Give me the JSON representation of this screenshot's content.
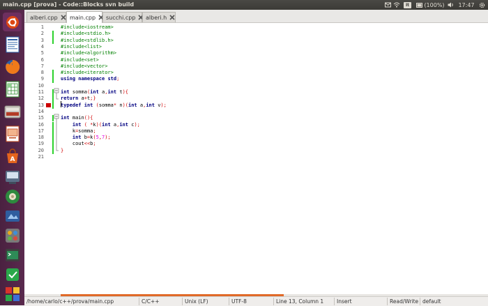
{
  "window": {
    "title": "main.cpp [prova] - Code::Blocks svn build"
  },
  "panel": {
    "keyboard": "It",
    "battery": "(100%)",
    "time": "17:47"
  },
  "launcher": {
    "items": [
      {
        "name": "ubuntu-dash-icon"
      },
      {
        "name": "libreoffice-writer-icon"
      },
      {
        "name": "firefox-icon"
      },
      {
        "name": "libreoffice-calc-icon"
      },
      {
        "name": "file-manager-icon"
      },
      {
        "name": "libreoffice-impress-icon"
      },
      {
        "name": "software-center-icon"
      },
      {
        "name": "app-icon-1"
      },
      {
        "name": "app-icon-2"
      },
      {
        "name": "app-icon-3"
      },
      {
        "name": "app-icon-4"
      },
      {
        "name": "app-icon-5"
      },
      {
        "name": "app-icon-6"
      },
      {
        "name": "app-icon-7"
      },
      {
        "name": "workspaces-icon"
      }
    ]
  },
  "tabs": [
    {
      "label": "alberi.cpp",
      "active": false
    },
    {
      "label": "main.cpp",
      "active": true
    },
    {
      "label": "succhi.cpp",
      "active": false
    },
    {
      "label": "alberi.h",
      "active": false
    }
  ],
  "code_lines": [
    {
      "n": "1",
      "text": "#include<iostream>"
    },
    {
      "n": "2",
      "text": "#include<stdio.h>"
    },
    {
      "n": "3",
      "text": "#include<stdlib.h>"
    },
    {
      "n": "4",
      "text": "#include<list>"
    },
    {
      "n": "5",
      "text": "#include<algorithm>"
    },
    {
      "n": "6",
      "text": "#include<set>"
    },
    {
      "n": "7",
      "text": "#include<vector>"
    },
    {
      "n": "8",
      "text": "#include<iterator>"
    },
    {
      "n": "9",
      "text": "using namespace std;"
    },
    {
      "n": "10",
      "text": ""
    },
    {
      "n": "11",
      "text": "int somma(int a,int t){"
    },
    {
      "n": "12",
      "text": "return a+t;}"
    },
    {
      "n": "13",
      "text": "typedef int (somma* n)(int a,int v);"
    },
    {
      "n": "14",
      "text": ""
    },
    {
      "n": "15",
      "text": "int main(){"
    },
    {
      "n": "16",
      "text": "    int ( *k)(int a,int c);"
    },
    {
      "n": "17",
      "text": "    k=somma;"
    },
    {
      "n": "18",
      "text": "    int b=k(5,7);"
    },
    {
      "n": "19",
      "text": "    cout<<b;"
    },
    {
      "n": "20",
      "text": "}"
    },
    {
      "n": "21",
      "text": ""
    }
  ],
  "status": {
    "path": "/home/carlo/c++/prova/main.cpp",
    "language": "C/C++",
    "line_endings": "Unix (LF)",
    "encoding": "UTF-8",
    "position": "Line 13, Column 1",
    "mode": "Insert",
    "access": "Read/Write",
    "profile": "default"
  },
  "colors": {
    "preprocessor": "#008000",
    "keyword": "#000080",
    "operator": "#d00000",
    "number": "#e000e0",
    "changebar": "#2bd12b",
    "error_marker": "#cc0000"
  }
}
